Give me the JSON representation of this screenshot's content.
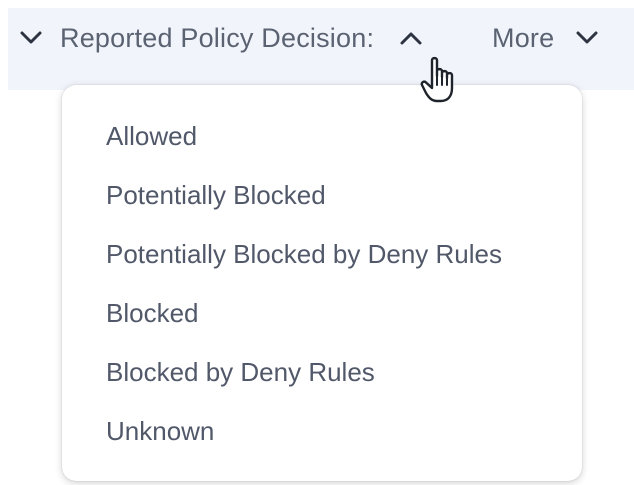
{
  "filter_bar": {
    "policy_filter_label": "Reported Policy Decision:",
    "more_label": "More"
  },
  "icons": {
    "policy_collapse": "chevron-down-icon",
    "policy_toggle": "chevron-up-icon",
    "more_toggle": "chevron-down-icon",
    "cursor": "hand-pointer-icon"
  },
  "dropdown": {
    "options": [
      "Allowed",
      "Potentially Blocked",
      "Potentially Blocked by Deny Rules",
      "Blocked",
      "Blocked by Deny Rules",
      "Unknown"
    ]
  },
  "colors": {
    "bar_background": "#f1f5fb",
    "text": "#5b6272",
    "icon": "#2d3340"
  }
}
